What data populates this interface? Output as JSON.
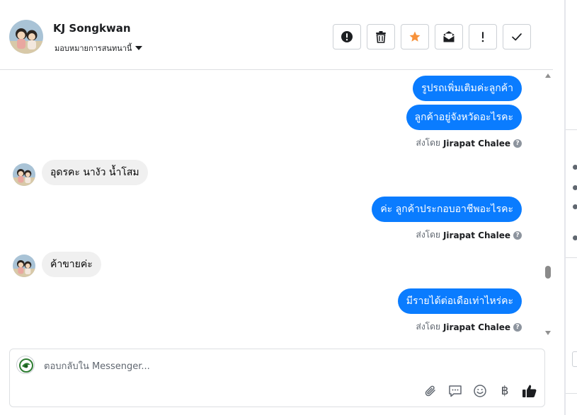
{
  "contact": {
    "name": "KJ Songkwan",
    "assign_label": "มอบหมายการสนทนานี้"
  },
  "header_actions": [
    {
      "name": "spam-button",
      "icon": "exclamation-circle-icon"
    },
    {
      "name": "delete-button",
      "icon": "trash-icon"
    },
    {
      "name": "star-button",
      "icon": "star-icon",
      "color": "#f7923b"
    },
    {
      "name": "mark-unread-button",
      "icon": "open-envelope-icon"
    },
    {
      "name": "follow-up-button",
      "icon": "exclamation-icon"
    },
    {
      "name": "mark-done-button",
      "icon": "check-icon"
    }
  ],
  "messages": [
    {
      "direction": "out",
      "text": "รูปรถเพิ่มเติมค่ะลูกค้า"
    },
    {
      "direction": "out",
      "text": "ลูกค้าอยู่จังหวัดอะไรคะ"
    },
    {
      "direction": "meta",
      "sent_by_label": "ส่งโดย",
      "agent": "Jirapat Chalee"
    },
    {
      "direction": "in",
      "text": "อุดรคะ นางัว น้ำโสม"
    },
    {
      "direction": "out",
      "text": "ค่ะ ลูกค้าประกอบอาชีพอะไรคะ"
    },
    {
      "direction": "meta",
      "sent_by_label": "ส่งโดย",
      "agent": "Jirapat Chalee"
    },
    {
      "direction": "in",
      "text": "ค้าขายค่ะ"
    },
    {
      "direction": "out",
      "text": "มีรายได้ต่อเดือเท่าไหร่คะ"
    },
    {
      "direction": "meta",
      "sent_by_label": "ส่งโดย",
      "agent": "Jirapat Chalee"
    }
  ],
  "composer": {
    "placeholder": "ตอบกลับใน Messenger...",
    "tools": [
      "paperclip-icon",
      "saved-reply-icon",
      "emoji-icon",
      "baht-icon",
      "thumbs-up-icon"
    ],
    "baht_symbol": "฿"
  },
  "colors": {
    "outgoing_bubble": "#0a7cff",
    "incoming_bubble": "#f0f0f0",
    "star": "#f7923b"
  }
}
